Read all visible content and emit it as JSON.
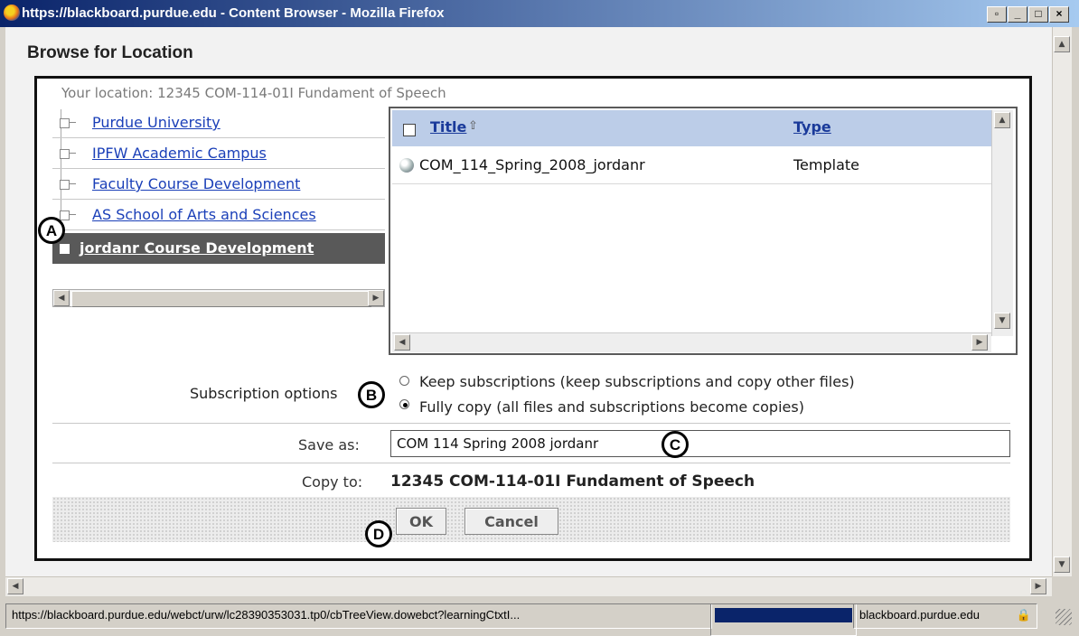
{
  "window": {
    "title": "https://blackboard.purdue.edu - Content Browser - Mozilla Firefox",
    "controls": [
      "▫",
      "_",
      "□",
      "×"
    ]
  },
  "page": {
    "heading": "Browse for Location"
  },
  "location": {
    "text": "Your location: 12345 COM-114-01I Fundament of Speech"
  },
  "tree": {
    "items": [
      {
        "label": "Purdue University"
      },
      {
        "label": "IPFW Academic Campus"
      },
      {
        "label": "Faculty Course Development"
      },
      {
        "label": "AS School of Arts and Sciences"
      },
      {
        "label": "jordanr Course Development",
        "selected": true
      }
    ],
    "scroll_left": "◀",
    "scroll_right": "▶"
  },
  "list": {
    "columns": {
      "title": "Title",
      "sort_icon": "⇧",
      "type": "Type"
    },
    "rows": [
      {
        "name": "COM_114_Spring_2008_jordanr",
        "type": "Template",
        "icon": "globe-icon"
      }
    ],
    "scroll_up": "▲",
    "scroll_down": "▼",
    "scroll_left": "◀",
    "scroll_right": "▶"
  },
  "subscription": {
    "label": "Subscription options",
    "options": [
      {
        "label": "Keep subscriptions (keep subscriptions and copy other files)",
        "selected": false
      },
      {
        "label": "Fully copy (all files and subscriptions become copies)",
        "selected": true
      }
    ]
  },
  "save_as": {
    "label": "Save as:",
    "value": "COM 114 Spring 2008 jordanr"
  },
  "copy_to": {
    "label": "Copy to:",
    "value": "12345 COM-114-01I Fundament of Speech"
  },
  "buttons": {
    "ok": "OK",
    "cancel": "Cancel"
  },
  "callouts": {
    "a": "A",
    "b": "B",
    "c": "C",
    "d": "D"
  },
  "page_scroll": {
    "up": "▲",
    "down": "▼",
    "left": "◀",
    "right": "▶"
  },
  "statusbar": {
    "url": "https://blackboard.purdue.edu/webct/urw/lc28390353031.tp0/cbTreeView.dowebct?learningCtxtI...",
    "domain": "blackboard.purdue.edu",
    "lock_icon": "lock-icon"
  },
  "colors": {
    "accent": "#1a3fb8",
    "selected_row": "#595959",
    "list_header": "#bccde8",
    "progress": "#0a246a"
  }
}
